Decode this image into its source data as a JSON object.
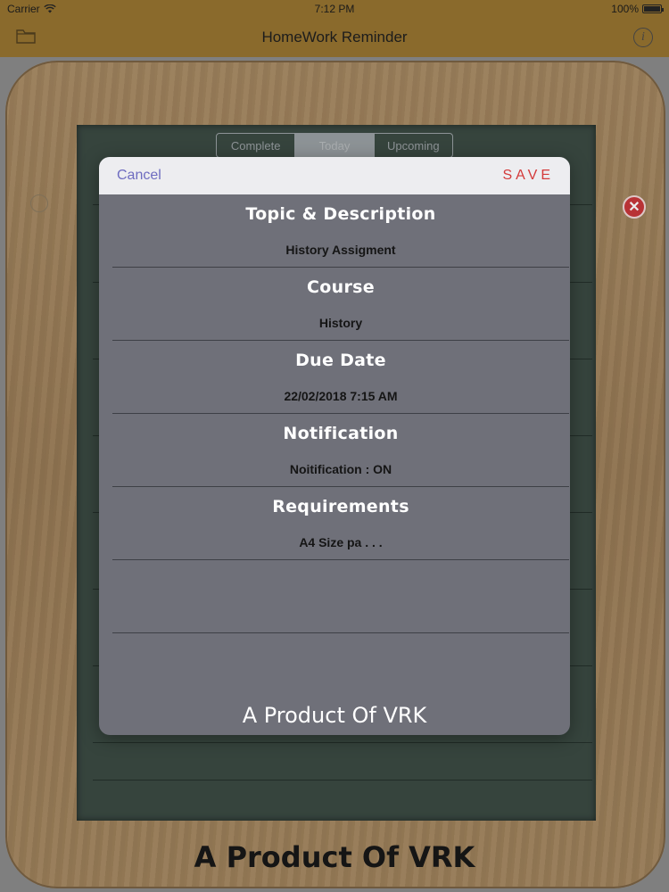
{
  "status_bar": {
    "carrier": "Carrier",
    "time": "7:12 PM",
    "battery": "100%"
  },
  "nav": {
    "title": "HomeWork Reminder",
    "left_icon": "folder-icon",
    "right_icon": "info-icon"
  },
  "segments": [
    {
      "label": "Complete",
      "selected": false
    },
    {
      "label": "Today",
      "selected": true
    },
    {
      "label": "Upcoming",
      "selected": false
    }
  ],
  "modal": {
    "cancel_label": "Cancel",
    "save_label": "SAVE",
    "fields": [
      {
        "title": "Topic & Description",
        "value": "History Assigment"
      },
      {
        "title": "Course",
        "value": "History"
      },
      {
        "title": "Due Date",
        "value": "22/02/2018 7:15 AM"
      },
      {
        "title": "Notification",
        "value": "Noitification : ON"
      },
      {
        "title": "Requirements",
        "value": "A4 Size pa . . ."
      },
      {
        "title": "",
        "value": ""
      }
    ],
    "footer": "A Product Of VRK"
  },
  "footer": "A Product Of VRK",
  "colors": {
    "nav_bar": "#8a6a2c",
    "board": "#3b4a43",
    "modal_bg": "#6f7079",
    "save": "#d43a3a",
    "cancel": "#6e6cc0",
    "delete": "#c8373a"
  }
}
